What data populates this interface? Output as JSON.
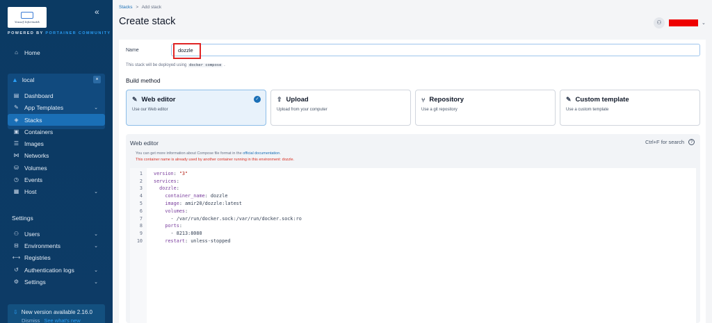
{
  "sidebar": {
    "logo_caption": "Yousef Informatik",
    "powered_prefix": "POWERED BY ",
    "powered_brand": "PORTAINER COMMUNITY",
    "home": "Home",
    "environment": "local",
    "items": [
      {
        "label": "Dashboard",
        "icon": "dashboard-icon"
      },
      {
        "label": "App Templates",
        "icon": "edit-icon"
      },
      {
        "label": "Stacks",
        "icon": "layers-icon"
      },
      {
        "label": "Containers",
        "icon": "box-icon"
      },
      {
        "label": "Images",
        "icon": "list-icon"
      },
      {
        "label": "Networks",
        "icon": "network-icon"
      },
      {
        "label": "Volumes",
        "icon": "database-icon"
      },
      {
        "label": "Events",
        "icon": "clock-icon"
      },
      {
        "label": "Host",
        "icon": "server-icon"
      }
    ],
    "settings_title": "Settings",
    "settings_items": [
      {
        "label": "Users"
      },
      {
        "label": "Environments"
      },
      {
        "label": "Registries"
      },
      {
        "label": "Authentication logs"
      },
      {
        "label": "Settings"
      }
    ],
    "update_title": "New version available 2.16.0",
    "update_dismiss": "Dismiss",
    "update_link": "See what's new"
  },
  "header": {
    "crumb_stacks": "Stacks",
    "crumb_sep": ">",
    "crumb_current": "Add stack",
    "title": "Create stack"
  },
  "form": {
    "name_label": "Name",
    "name_value": "dozzle",
    "hint_prefix": "This stack will be deployed using",
    "hint_code": "docker compose",
    "hint_suffix": ".",
    "build_method_title": "Build method",
    "methods": [
      {
        "title": "Web editor",
        "desc": "Use our Web editor"
      },
      {
        "title": "Upload",
        "desc": "Upload from your computer"
      },
      {
        "title": "Repository",
        "desc": "Use a git repository"
      },
      {
        "title": "Custom template",
        "desc": "Use a custom template"
      }
    ]
  },
  "editor": {
    "title": "Web editor",
    "search_hint": "Ctrl+F for search",
    "info_prefix": "You can get more information about Compose file format in the",
    "info_link": "official documentation",
    "info_suffix": ".",
    "warning": "This container name is already used by another container running in this environment: dozzle.",
    "lines": [
      {
        "n": "1",
        "k": "version",
        "v": " \"3\""
      },
      {
        "n": "2",
        "k": "services",
        "v": ""
      },
      {
        "n": "3",
        "k": "  dozzle",
        "v": ""
      },
      {
        "n": "4",
        "k": "    container_name",
        "v": " dozzle"
      },
      {
        "n": "5",
        "k": "    image",
        "v": " amir20/dozzle:latest"
      },
      {
        "n": "6",
        "k": "    volumes",
        "v": ""
      },
      {
        "n": "7",
        "k": "",
        "v": "      - /var/run/docker.sock:/var/run/docker.sock:ro"
      },
      {
        "n": "8",
        "k": "    ports",
        "v": ""
      },
      {
        "n": "9",
        "k": "",
        "v": "      - 8213:8080"
      },
      {
        "n": "10",
        "k": "    restart",
        "v": " unless-stopped"
      }
    ]
  }
}
